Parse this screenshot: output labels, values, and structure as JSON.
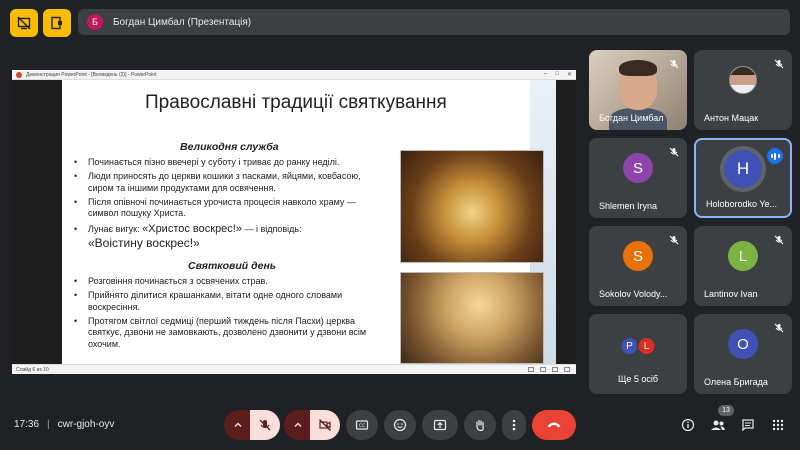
{
  "presenter": {
    "initial": "Б",
    "label": "Богдан Цимбал (Презентація)"
  },
  "powerpoint": {
    "window_title": "Демонстрация PowerPoint - [Великдень (2)] - PowerPoint",
    "status": "Слайд 6 из 10"
  },
  "slide": {
    "title": "Православні традиції святкування",
    "heading1": "Великодня служба",
    "bullets1": [
      "Починається пізно ввечері у суботу і триває до ранку неділі.",
      "Люди приносять до церкви кошики з пасками, яйцями, ковбасою, сиром та іншими продуктами для освячення.",
      "Після опівночі починається урочиста процесія навколо храму — символ пошуку Христа.",
      "Лунає вигук: «Христос воскрес!» — і відповідь: «Воістину воскрес!»"
    ],
    "bullet_big_a": "«Христос воскрес!»",
    "bullet_small_b": " — і відповідь:",
    "bullet_big_c": "«Воістину воскрес!»",
    "bullet_prefix": "Лунає вигук: ",
    "heading2": "Святковий день",
    "bullets2": [
      "Розговіння починається з освячених страв.",
      "Прийнято ділитися крашанками, вітати одне одного словами воскресіння.",
      "Протягом світлої седмиці (перший тиждень після Пасхи) церква святкує, дзвони не замовкають, дозволено дзвонити у дзвони всім охочим."
    ]
  },
  "participants": [
    {
      "name": "Богдан Цимбал",
      "type": "video"
    },
    {
      "name": "Антон Мацак",
      "type": "photo"
    },
    {
      "name": "Shlemen Iryna",
      "initial": "S",
      "color": "#8e44ad"
    },
    {
      "name": "Holoborodko Ye...",
      "initial": "H",
      "color": "#3f51b5",
      "speaking": true
    },
    {
      "name": "Sokolov Volody...",
      "initial": "S",
      "color": "#e8710a"
    },
    {
      "name": "Lantinov Ivan",
      "initial": "L",
      "color": "#7cb342"
    },
    {
      "name": "Ще 5 осіб",
      "initials": [
        "P",
        "L"
      ],
      "colors": [
        "#3f51b5",
        "#d93025"
      ]
    },
    {
      "name": "Олена Бригада",
      "initial": "О",
      "color": "#3f51b5"
    }
  ],
  "bottom": {
    "time": "17:36",
    "separator": "|",
    "meeting_code": "cwr-gjoh-oyv",
    "people_count": "13"
  },
  "colors": {
    "accent": "#fbbc04",
    "end_call": "#ea4335",
    "speaking": "#1a73e8"
  }
}
